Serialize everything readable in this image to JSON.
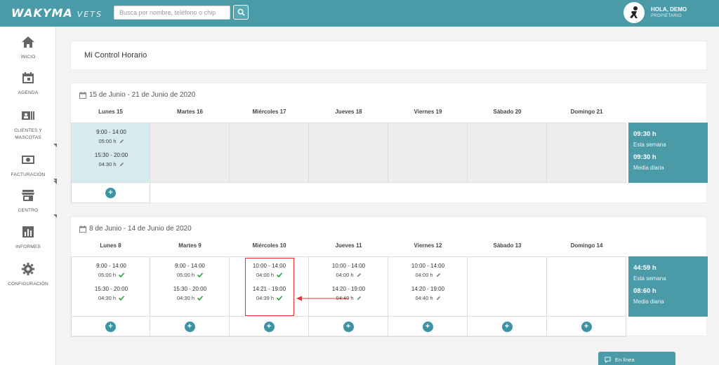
{
  "app": {
    "logo": "WAKYMA",
    "logo_sub": "VETS"
  },
  "search": {
    "placeholder": "Busca por nombre, teléfono o chip"
  },
  "user": {
    "greeting": "HOLA, DEMO",
    "role": "PROPIETARIO"
  },
  "sidebar": {
    "items": [
      {
        "label": "INICIO",
        "icon": "home-icon"
      },
      {
        "label": "AGENDA",
        "icon": "calendar-icon"
      },
      {
        "label": "CLIENTES Y MASCOTAS",
        "icon": "contacts-icon"
      },
      {
        "label": "FACTURACIÓN",
        "icon": "money-icon"
      },
      {
        "label": "CENTRO",
        "icon": "store-icon"
      },
      {
        "label": "INFORMES",
        "icon": "chart-icon"
      },
      {
        "label": "CONFIGURACIÓN",
        "icon": "gear-icon"
      }
    ]
  },
  "page": {
    "title": "Mi Control Horario"
  },
  "weeks": [
    {
      "range": "15 de Junio - 21 de Junio de 2020",
      "days": [
        "Lunes 15",
        "Martes 16",
        "Miércoles 17",
        "Jueves 18",
        "Viernes 19",
        "Sábado 20",
        "Domingo 21"
      ],
      "entries": [
        [
          {
            "time": "9:00 - 14:00",
            "dur": "05:00 h",
            "status": "edit"
          },
          {
            "time": "15:30 - 20:00",
            "dur": "04:30 h",
            "status": "edit"
          }
        ],
        [],
        [],
        [],
        [],
        [],
        []
      ],
      "summary": {
        "week_total": "09:30 h",
        "week_label": "Esta semana",
        "avg": "09:30 h",
        "avg_label": "Media diaria"
      }
    },
    {
      "range": "8 de Junio - 14 de Junio de 2020",
      "days": [
        "Lunes 8",
        "Martes 9",
        "Miércoles 10",
        "Jueves 11",
        "Viernes 12",
        "Sábado 13",
        "Domingo 14"
      ],
      "entries": [
        [
          {
            "time": "9:00 - 14:00",
            "dur": "05:00 h",
            "status": "ok"
          },
          {
            "time": "15:30 - 20:00",
            "dur": "04:30 h",
            "status": "ok"
          }
        ],
        [
          {
            "time": "9:00 - 14:00",
            "dur": "05:00 h",
            "status": "ok"
          },
          {
            "time": "15:30 - 20:00",
            "dur": "04:30 h",
            "status": "ok"
          }
        ],
        [
          {
            "time": "10:00 - 14:00",
            "dur": "04:00 h",
            "status": "ok"
          },
          {
            "time": "14:21 - 19:00",
            "dur": "04:39 h",
            "status": "ok"
          }
        ],
        [
          {
            "time": "10:00 - 14:00",
            "dur": "04:00 h",
            "status": "edit"
          },
          {
            "time": "14:20 - 19:00",
            "dur": "04:40 h",
            "status": "edit"
          }
        ],
        [
          {
            "time": "10:00 - 14:00",
            "dur": "04:00 h",
            "status": "edit"
          },
          {
            "time": "14:20 - 19:00",
            "dur": "04:40 h",
            "status": "edit"
          }
        ],
        [],
        []
      ],
      "summary": {
        "week_total": "44:59 h",
        "week_label": "Esta semana",
        "avg": "08:60 h",
        "avg_label": "Media diaria"
      }
    }
  ],
  "chat": {
    "label": "En línea"
  },
  "colors": {
    "primary": "#4a9aa8",
    "check": "#2e9e44",
    "highlight": "#e33333",
    "active_cell": "#d7eaee"
  }
}
